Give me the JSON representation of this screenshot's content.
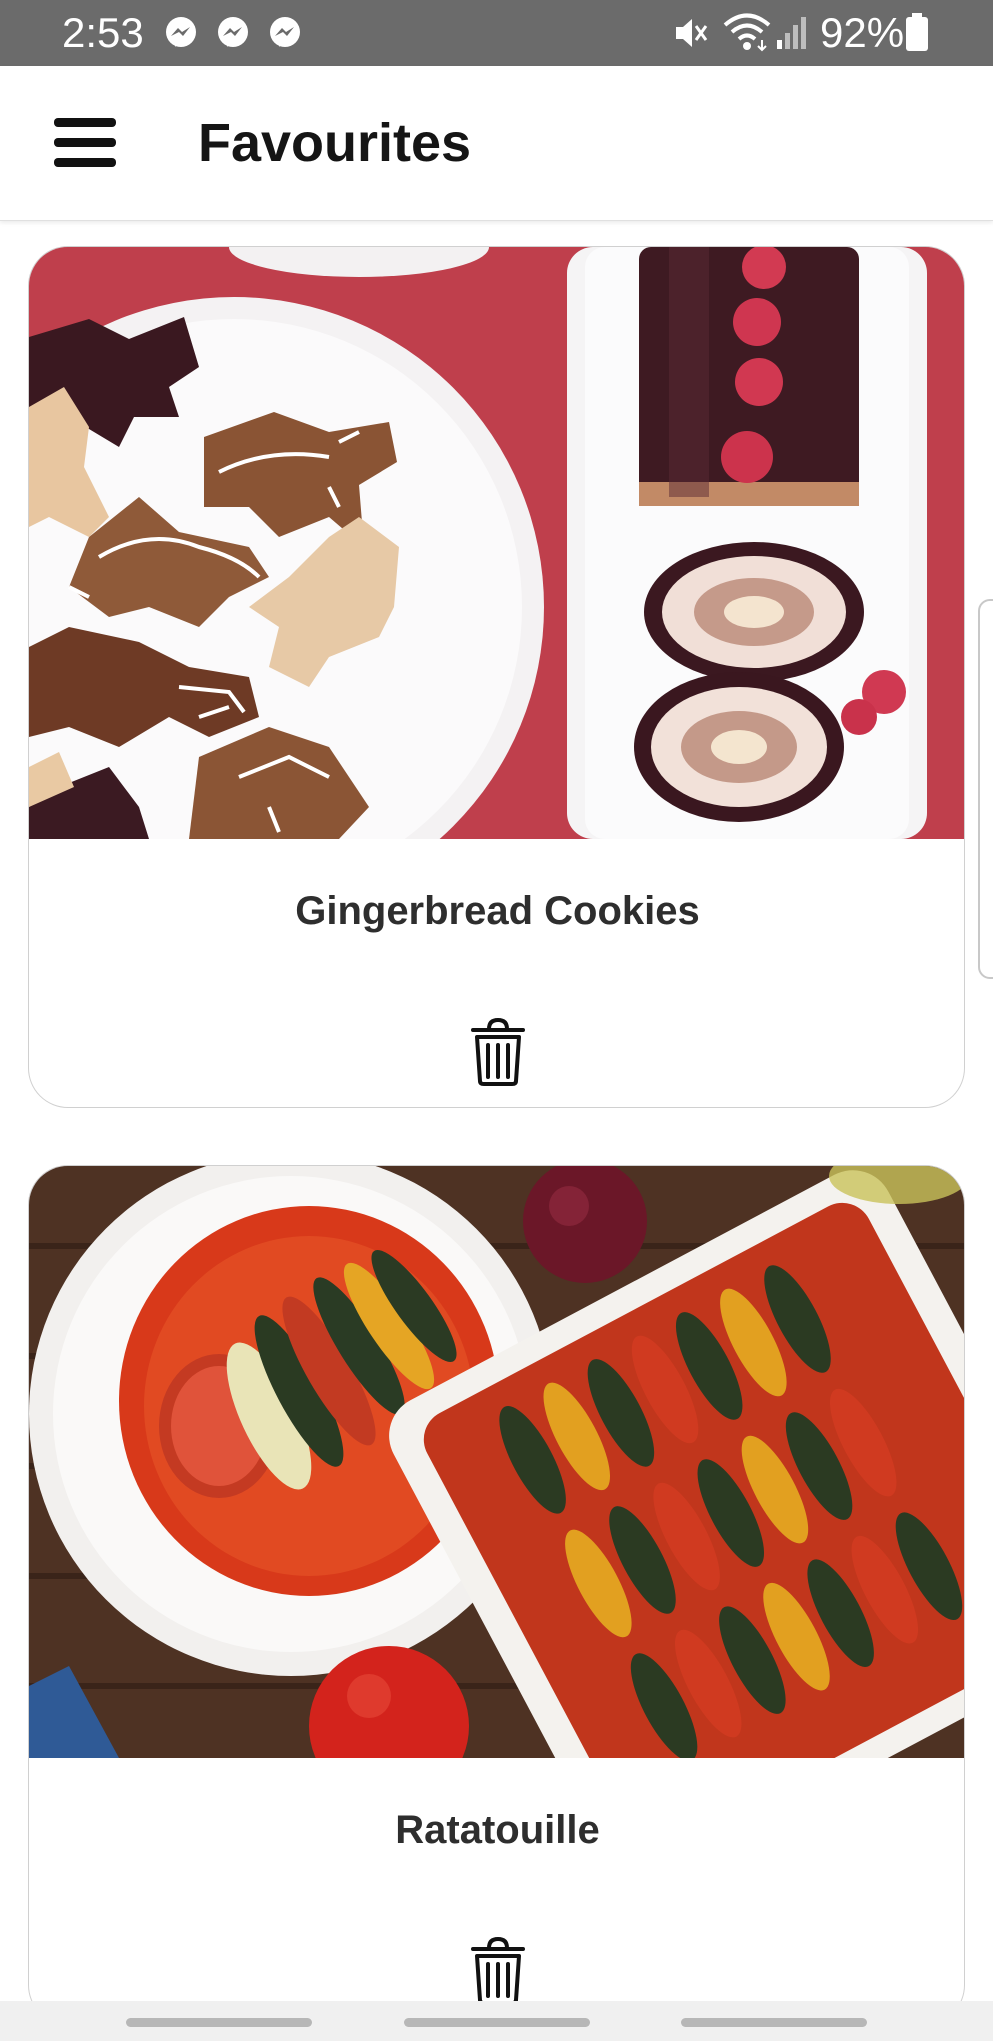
{
  "status_bar": {
    "time": "2:53",
    "notification_icons": [
      "messenger-icon",
      "messenger-icon",
      "messenger-icon"
    ],
    "system_icons": [
      "mute-icon",
      "wifi-icon",
      "signal-icon",
      "battery-icon"
    ],
    "battery": "92%"
  },
  "app_bar": {
    "menu_icon": "hamburger-menu-icon",
    "title": "Favourites"
  },
  "favourites": [
    {
      "title": "Gingerbread Cookies",
      "image": "gingerbread-cookies-photo",
      "action_icon": "trash-icon"
    },
    {
      "title": "Ratatouille",
      "image": "ratatouille-photo",
      "action_icon": "trash-icon"
    }
  ],
  "colors": {
    "status_bar": "#6b6b6b",
    "title_text": "#151515",
    "card_title": "#2e2e2e",
    "card_border": "#d0d0d0"
  }
}
